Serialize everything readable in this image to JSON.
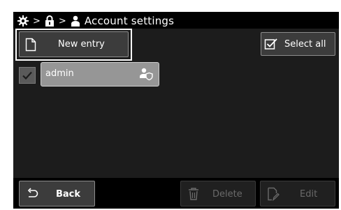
{
  "header": {
    "breadcrumb_separator_1": ">",
    "breadcrumb_separator_2": ">",
    "title": "Account settings",
    "icons": [
      "gear-icon",
      "lock-icon",
      "user-icon"
    ]
  },
  "toolbar": {
    "new_entry_label": "New entry",
    "select_all_label": "Select all"
  },
  "accounts": [
    {
      "name": "admin",
      "checked": true,
      "role_icon": "user-shield-icon"
    }
  ],
  "footer": {
    "back_label": "Back",
    "delete_label": "Delete",
    "edit_label": "Edit"
  },
  "colors": {
    "background": "#000000",
    "content_background": "#1c1c1c",
    "button": "#3c3c3c",
    "selected_item": "#969696",
    "disabled_text": "#6a6a6a"
  }
}
